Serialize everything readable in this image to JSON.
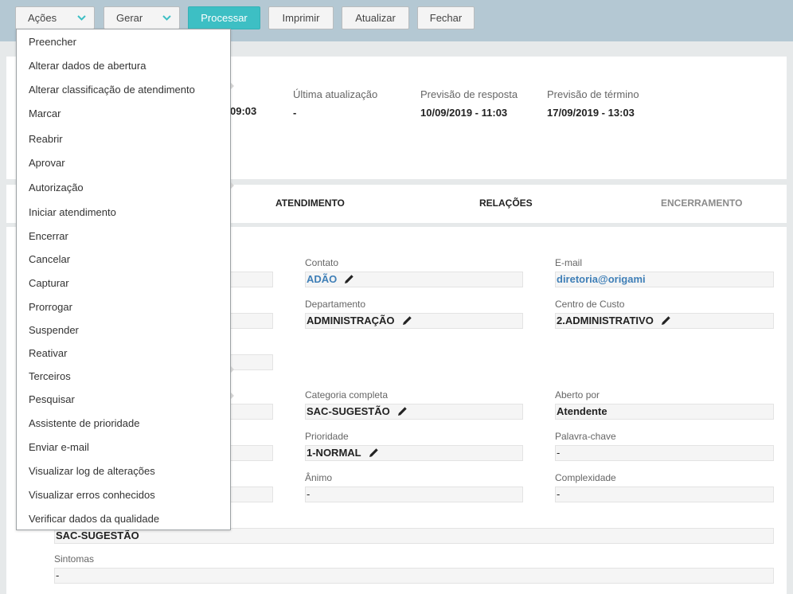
{
  "toolbar": {
    "acoes": "Ações",
    "gerar": "Gerar",
    "processar": "Processar",
    "imprimir": "Imprimir",
    "atualizar": "Atualizar",
    "fechar": "Fechar"
  },
  "header": {
    "partial_time": "09:03",
    "ultima_atualizacao": {
      "label": "Última atualização",
      "value": "-"
    },
    "previsao_resposta": {
      "label": "Previsão de resposta",
      "value": "10/09/2019 - 11:03"
    },
    "previsao_termino": {
      "label": "Previsão de término",
      "value": "17/09/2019 - 13:03"
    }
  },
  "tabs": {
    "atendimento": "ATENDIMENTO",
    "relacoes": "RELAÇÕES",
    "encerramento": "ENCERRAMENTO"
  },
  "fields": {
    "contato": {
      "label": "Contato",
      "value": "ADÃO"
    },
    "email": {
      "label": "E-mail",
      "value": "diretoria@origami"
    },
    "departamento": {
      "label": "Departamento",
      "value": "ADMINISTRAÇÃO"
    },
    "centro_custo": {
      "label": "Centro de Custo",
      "value": "2.ADMINISTRATIVO"
    },
    "categoria": {
      "label": "Categoria completa",
      "value": "SAC-SUGESTÃO"
    },
    "aberto_por": {
      "label": "Aberto por",
      "value": "Atendente"
    },
    "prioridade": {
      "label": "Prioridade",
      "value": "1-NORMAL"
    },
    "palavra_chave": {
      "label": "Palavra-chave",
      "value": "-"
    },
    "animo": {
      "label": "Ânimo",
      "value": "-"
    },
    "complexidade": {
      "label": "Complexidade",
      "value": "-"
    },
    "assunto": {
      "value": "SAC-SUGESTÃO"
    },
    "sintomas": {
      "label": "Sintomas",
      "value": "-"
    }
  },
  "menu": {
    "items": [
      "Preencher",
      "Alterar dados de abertura",
      "Alterar classificação de atendimento",
      "Marcar",
      "Reabrir",
      "Aprovar",
      "Autorização",
      "Iniciar atendimento",
      "Encerrar",
      "Cancelar",
      "Capturar",
      "Prorrogar",
      "Suspender",
      "Reativar",
      "Terceiros",
      "Pesquisar",
      "Assistente de prioridade",
      "Enviar e-mail",
      "Visualizar log de alterações",
      "Visualizar erros conhecidos",
      "Verificar dados da qualidade"
    ]
  },
  "colors": {
    "topbar": "#b4c8d3",
    "primary": "#3dbfc4",
    "link": "#3f7fb7"
  },
  "icons": [
    "chevron-down-icon",
    "pencil-icon"
  ]
}
